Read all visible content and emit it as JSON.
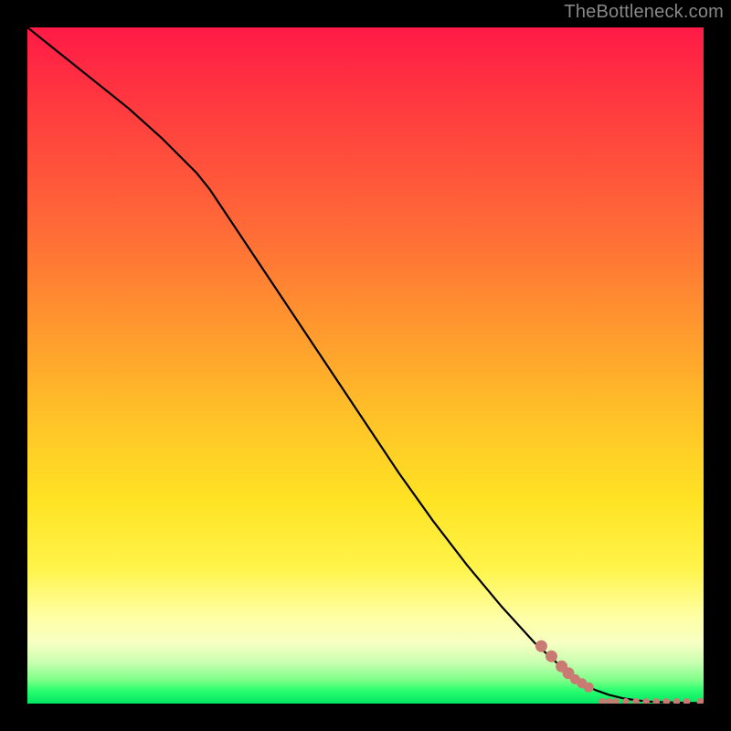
{
  "watermark": "TheBottleneck.com",
  "colors": {
    "frame_bg": "#000000",
    "gradient_stops": [
      "#ff1a46",
      "#ff3b3f",
      "#ff6b37",
      "#ff9a2e",
      "#ffc328",
      "#ffe324",
      "#fff44a",
      "#ffffa3",
      "#f7ffc2",
      "#c8ffb0",
      "#7eff88",
      "#2dff70",
      "#00e663"
    ],
    "curve": "#000000",
    "point_fill": "#c97a72"
  },
  "chart_data": {
    "type": "line",
    "title": "",
    "xlabel": "",
    "ylabel": "",
    "xlim": [
      0,
      100
    ],
    "ylim": [
      0,
      100
    ],
    "grid": false,
    "series": [
      {
        "name": "bottleneck-curve",
        "x": [
          0,
          5,
          10,
          15,
          20,
          25,
          27,
          30,
          35,
          40,
          45,
          50,
          55,
          60,
          65,
          70,
          75,
          80,
          82,
          84,
          86,
          88,
          90,
          92,
          94,
          96,
          98,
          100
        ],
        "y": [
          100,
          96,
          92,
          88,
          83.5,
          78.5,
          76,
          71.5,
          64,
          56.5,
          49,
          41.5,
          34,
          27,
          20.5,
          14.5,
          9,
          4.5,
          3,
          2,
          1.3,
          0.8,
          0.5,
          0.3,
          0.2,
          0.15,
          0.1,
          0.1
        ]
      }
    ],
    "scatter": {
      "name": "data-points",
      "points": [
        {
          "x": 76,
          "y": 8.5,
          "size": "lg"
        },
        {
          "x": 77.5,
          "y": 7,
          "size": "lg"
        },
        {
          "x": 79,
          "y": 5.5,
          "size": "lg"
        },
        {
          "x": 80,
          "y": 4.5,
          "size": "lg"
        },
        {
          "x": 81,
          "y": 3.6,
          "size": "md"
        },
        {
          "x": 82,
          "y": 3.0,
          "size": "md"
        },
        {
          "x": 83,
          "y": 2.4,
          "size": "md"
        },
        {
          "x": 85,
          "y": 0.3,
          "size": "sm"
        },
        {
          "x": 86,
          "y": 0.3,
          "size": "sm"
        },
        {
          "x": 87,
          "y": 0.3,
          "size": "sm"
        },
        {
          "x": 88.5,
          "y": 0.3,
          "size": "sm"
        },
        {
          "x": 90,
          "y": 0.3,
          "size": "sm"
        },
        {
          "x": 91.5,
          "y": 0.3,
          "size": "sm"
        },
        {
          "x": 93,
          "y": 0.3,
          "size": "sm"
        },
        {
          "x": 94.5,
          "y": 0.3,
          "size": "sm"
        },
        {
          "x": 96,
          "y": 0.3,
          "size": "sm"
        },
        {
          "x": 97.5,
          "y": 0.3,
          "size": "sm"
        },
        {
          "x": 99.5,
          "y": 0.3,
          "size": "sm"
        }
      ]
    }
  }
}
